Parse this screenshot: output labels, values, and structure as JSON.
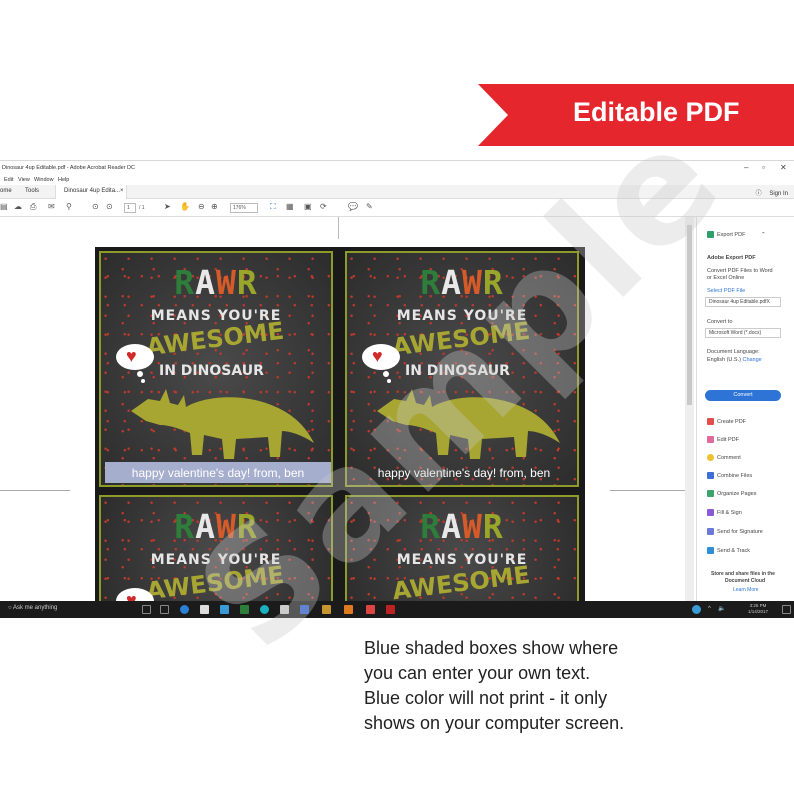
{
  "banner": {
    "label": "Editable PDF",
    "color": "#e5262d"
  },
  "app": {
    "title": "Dinosaur 4up Editable.pdf - Adobe Acrobat Reader DC",
    "menu": [
      "Edit",
      "View",
      "Window",
      "Help"
    ],
    "tabs": {
      "home": "ome",
      "tools": "Tools",
      "doc": "Dinosaur 4up Edita..."
    },
    "signin": "Sign In",
    "page_field": "1",
    "page_total": "/ 1",
    "zoom": "176%"
  },
  "cards": [
    {
      "rawr": [
        "R",
        "A",
        "W",
        "R"
      ],
      "means": "MEANS YOU'RE",
      "awesome": "AWESOME",
      "in_dino": "IN DINOSAUR",
      "text": "happy valentine's day!  from, ben",
      "highlighted": true
    },
    {
      "rawr": [
        "R",
        "A",
        "W",
        "R"
      ],
      "means": "MEANS YOU'RE",
      "awesome": "AWESOME",
      "in_dino": "IN DINOSAUR",
      "text": "happy valentine's day!  from, ben",
      "highlighted": false
    },
    {
      "rawr": [
        "R",
        "A",
        "W",
        "R"
      ],
      "means": "MEANS YOU'RE",
      "awesome": "AWESOME"
    },
    {
      "rawr": [
        "R",
        "A",
        "W",
        "R"
      ],
      "means": "MEANS YOU'RE",
      "awesome": "AWESOME"
    }
  ],
  "right_panel": {
    "export_pdf": "Export PDF",
    "adobe_export": "Adobe Export PDF",
    "desc1": "Convert PDF Files to Word",
    "desc2": "or Excel Online",
    "select_label": "Select PDF File",
    "file": "Dinosaur 4up Editable.pdfX",
    "convert_to": "Convert to",
    "format": "Microsoft Word (*.docx)",
    "lang_label": "Document Language:",
    "lang": "English (U.S.)",
    "change": "Change",
    "convert_btn": "Convert",
    "tools": [
      "Create PDF",
      "Edit PDF",
      "Comment",
      "Combine Files",
      "Organize Pages",
      "Fill & Sign",
      "Send for Signature",
      "Send & Track"
    ],
    "cloud1": "Store and share files in the",
    "cloud2": "Document Cloud",
    "learn": "Learn More"
  },
  "taskbar": {
    "search": "Ask me anything",
    "time": "3:26 PM",
    "date": "1/14/2017"
  },
  "caption": [
    "Blue shaded boxes show where",
    "you can enter your own text.",
    "Blue color will not print - it only",
    "shows on your computer screen."
  ],
  "watermark": "Sample"
}
